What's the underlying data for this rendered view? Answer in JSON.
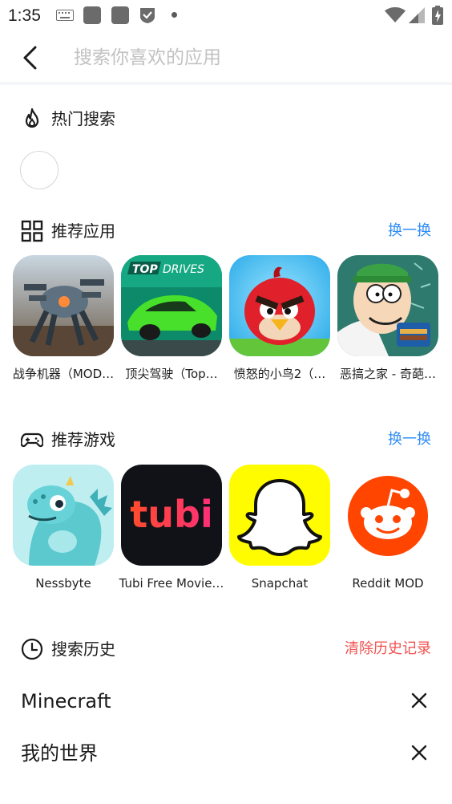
{
  "status_bar": {
    "time": "1:35",
    "icons": [
      "keyboard-icon",
      "app-square-icon",
      "app-square-icon",
      "shield-check-icon",
      "notification-dot",
      "wifi-icon",
      "signal-icon",
      "battery-charging-icon"
    ]
  },
  "search": {
    "placeholder": "搜索你喜欢的应用",
    "value": ""
  },
  "hot_search": {
    "title": "热门搜索",
    "icon": "flame-icon"
  },
  "recommended_apps": {
    "title": "推荐应用",
    "icon": "grid-icon",
    "refresh_label": "换一换",
    "items": [
      {
        "name": "战争机器（MOD…",
        "icon": "war-robots-icon"
      },
      {
        "name": "顶尖驾驶（Top…",
        "icon": "top-drives-icon"
      },
      {
        "name": "愤怒的小鸟2（…",
        "icon": "angry-birds-icon"
      },
      {
        "name": "恶搞之家 - 奇葩…",
        "icon": "family-guy-icon"
      }
    ]
  },
  "recommended_games": {
    "title": "推荐游戏",
    "icon": "gamepad-icon",
    "refresh_label": "换一换",
    "items": [
      {
        "name": "Nessbyte",
        "icon": "nessbyte-icon"
      },
      {
        "name": "Tubi Free Movie…",
        "icon": "tubi-icon",
        "logo_text": "tubi"
      },
      {
        "name": "Snapchat",
        "icon": "snapchat-icon"
      },
      {
        "name": "Reddit MOD",
        "icon": "reddit-icon"
      }
    ]
  },
  "search_history": {
    "title": "搜索历史",
    "icon": "clock-icon",
    "clear_label": "清除历史记录",
    "items": [
      "Minecraft",
      "我的世界"
    ]
  },
  "colors": {
    "link_blue": "#2f8df5",
    "clear_red": "#f0524f"
  }
}
